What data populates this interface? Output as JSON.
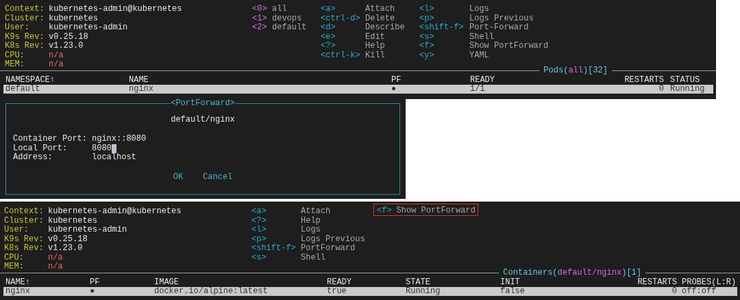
{
  "top_view": {
    "cluster_info": [
      {
        "label": "Context:",
        "value": "kubernetes-admin@kubernetes",
        "kind": "normal"
      },
      {
        "label": "Cluster:",
        "value": "kubernetes",
        "kind": "normal"
      },
      {
        "label": "User:",
        "value": "kubernetes-admin",
        "kind": "normal"
      },
      {
        "label": "K9s Rev:",
        "value": "v0.25.18",
        "kind": "normal"
      },
      {
        "label": "K8s Rev:",
        "value": "v1.23.0",
        "kind": "normal"
      },
      {
        "label": "CPU:",
        "value": "n/a",
        "kind": "unavailable"
      },
      {
        "label": "MEM:",
        "value": "n/a",
        "kind": "unavailable"
      }
    ],
    "namespaces": [
      {
        "key": "<0>",
        "name": "all"
      },
      {
        "key": "<1>",
        "name": "devops"
      },
      {
        "key": "<2>",
        "name": "default"
      }
    ],
    "hotkeys": [
      [
        {
          "key": "<a>",
          "action": "Attach",
          "highlighted": false
        },
        {
          "key": "<ctrl-d>",
          "action": "Delete",
          "highlighted": false
        },
        {
          "key": "<d>",
          "action": "Describe",
          "highlighted": false
        },
        {
          "key": "<e>",
          "action": "Edit",
          "highlighted": false
        },
        {
          "key": "<?>",
          "action": "Help",
          "highlighted": false
        },
        {
          "key": "<ctrl-k>",
          "action": "Kill",
          "highlighted": false
        }
      ],
      [
        {
          "key": "<l>",
          "action": "Logs",
          "highlighted": false
        },
        {
          "key": "<p>",
          "action": "Logs Previous",
          "highlighted": false
        },
        {
          "key": "<shift-f>",
          "action": "Port-Forward",
          "highlighted": false
        },
        {
          "key": "<s>",
          "action": "Shell",
          "highlighted": false
        },
        {
          "key": "<f>",
          "action": "Show PortForward",
          "highlighted": false
        },
        {
          "key": "<y>",
          "action": "YAML",
          "highlighted": false
        }
      ]
    ],
    "table": {
      "title_parts": [
        {
          "text": "Pods(",
          "kind": "plain"
        },
        {
          "text": "all",
          "kind": "scope"
        },
        {
          "text": ")[32]",
          "kind": "plain"
        }
      ],
      "columns": [
        "NAMESPACE↑",
        "NAME",
        "PF",
        "READY",
        "RESTARTS",
        "STATUS"
      ],
      "rows": [
        {
          "cells": [
            "default",
            "nginx",
            "●",
            "1/1",
            "0",
            "Running"
          ],
          "selected": true
        }
      ]
    }
  },
  "port_forward_dialog": {
    "title": "<PortForward>",
    "subtitle": "default/nginx",
    "fields": [
      {
        "label": "Container Port:",
        "value": "nginx::8080",
        "focused": false
      },
      {
        "label": "Local Port:",
        "value": "8080",
        "focused": true
      },
      {
        "label": "Address:",
        "value": "localhost",
        "focused": false
      }
    ],
    "buttons": [
      "OK",
      "Cancel"
    ]
  },
  "bottom_view": {
    "cluster_info": [
      {
        "label": "Context:",
        "value": "kubernetes-admin@kubernetes",
        "kind": "normal"
      },
      {
        "label": "Cluster:",
        "value": "kubernetes",
        "kind": "normal"
      },
      {
        "label": "User:",
        "value": "kubernetes-admin",
        "kind": "normal"
      },
      {
        "label": "K9s Rev:",
        "value": "v0.25.18",
        "kind": "normal"
      },
      {
        "label": "K8s Rev:",
        "value": "v1.23.0",
        "kind": "normal"
      },
      {
        "label": "CPU:",
        "value": "n/a",
        "kind": "unavailable"
      },
      {
        "label": "MEM:",
        "value": "n/a",
        "kind": "unavailable"
      }
    ],
    "hotkeys": [
      [
        {
          "key": "<a>",
          "action": "Attach",
          "highlighted": false
        },
        {
          "key": "<?>",
          "action": "Help",
          "highlighted": false
        },
        {
          "key": "<l>",
          "action": "Logs",
          "highlighted": false
        },
        {
          "key": "<p>",
          "action": "Logs Previous",
          "highlighted": false
        },
        {
          "key": "<shift-f>",
          "action": "PortForward",
          "highlighted": false
        },
        {
          "key": "<s>",
          "action": "Shell",
          "highlighted": false
        }
      ],
      [
        {
          "key": "<f>",
          "action": "Show PortForward",
          "highlighted": true
        }
      ]
    ],
    "table": {
      "title_parts": [
        {
          "text": "Containers(",
          "kind": "plain"
        },
        {
          "text": "default/nginx",
          "kind": "scope"
        },
        {
          "text": ")[1]",
          "kind": "plain"
        }
      ],
      "columns": [
        "NAME↑",
        "PF",
        "IMAGE",
        "READY",
        "STATE",
        "INIT",
        "RESTARTS",
        "PROBES(L:R)"
      ],
      "rows": [
        {
          "cells": [
            "nginx",
            "●",
            "docker.io/alpine:latest",
            "true",
            "Running",
            "false",
            "0",
            "off:off"
          ],
          "selected": true
        }
      ]
    }
  }
}
